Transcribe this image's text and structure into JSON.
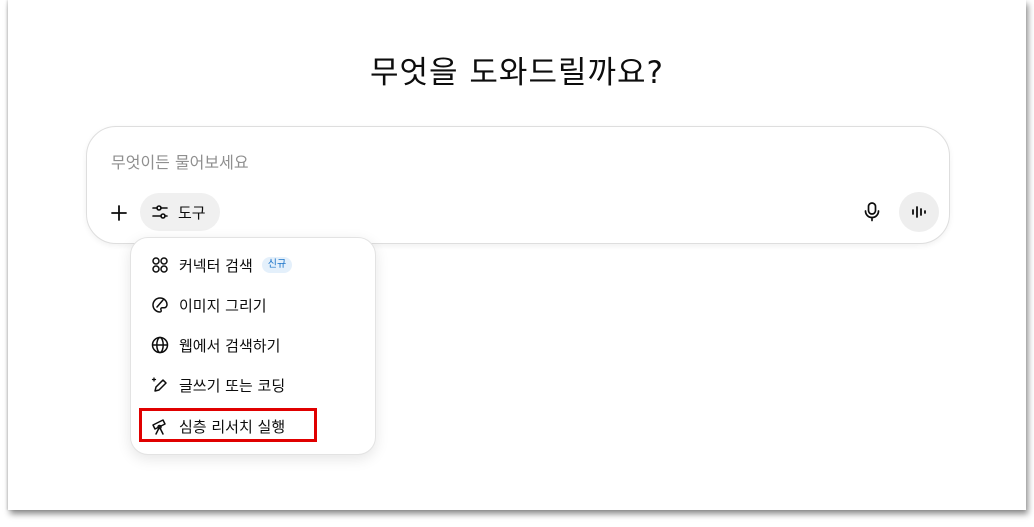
{
  "headline": "무엇을 도와드릴까요?",
  "composer": {
    "placeholder": "무엇이든 물어보세요",
    "tools_label": "도구"
  },
  "tools_menu": {
    "items": [
      {
        "label": "커넥터 검색",
        "icon": "connector-icon",
        "badge": "신규"
      },
      {
        "label": "이미지 그리기",
        "icon": "palette-icon"
      },
      {
        "label": "웹에서 검색하기",
        "icon": "globe-icon"
      },
      {
        "label": "글쓰기 또는 코딩",
        "icon": "pen-sparkle-icon"
      },
      {
        "label": "심층 리서치 실행",
        "icon": "telescope-icon",
        "highlighted": true
      }
    ]
  },
  "colors": {
    "highlight_border": "#e00000",
    "badge_text": "#1a73c8",
    "badge_bg": "#e4f0fb"
  }
}
